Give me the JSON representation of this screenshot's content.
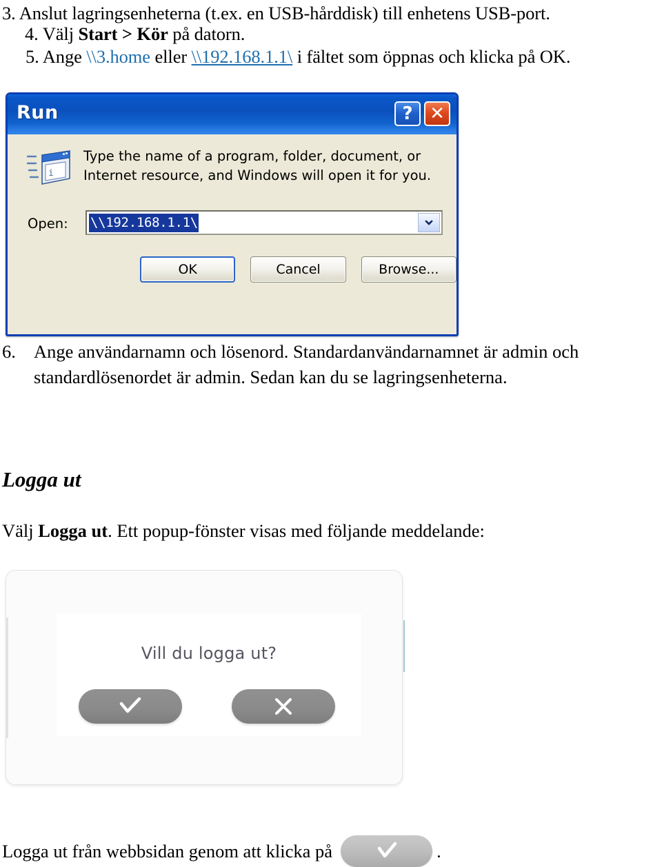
{
  "instructions": {
    "step3": {
      "number": "3.",
      "text": "Anslut lagringsenheterna (t.ex. en USB-hårddisk) till enhetens USB-port."
    },
    "step4": {
      "number": "4.",
      "prefix": "Välj ",
      "bold": "Start > Kör",
      "suffix": " på datorn."
    },
    "step5": {
      "number": "5.",
      "prefix": "Ange ",
      "link1": "\\\\3.home",
      "middle": " eller ",
      "link2": "\\\\192.168.1.1\\",
      "suffix": " i fältet som öppnas och klicka på OK."
    },
    "step6": {
      "number": "6.",
      "text": "Ange användarnamn och lösenord. Standardanvändarnamnet är admin och standardlösenordet är admin. Sedan kan du se lagringsenheterna."
    }
  },
  "run_dialog": {
    "title": "Run",
    "help_button": "?",
    "close_button": "✕",
    "description": "Type the name of a program, folder, document, or Internet resource, and Windows will open it for you.",
    "open_label": "Open:",
    "open_value": "\\\\192.168.1.1\\",
    "buttons": {
      "ok": "OK",
      "cancel": "Cancel",
      "browse": "Browse..."
    },
    "icon": "run-window-icon",
    "dropdown_icon": "chevron-down-icon",
    "selection_color": "#16389c",
    "titlebar_color": "#0b57c8"
  },
  "logout_section": {
    "heading": "Logga ut",
    "intro_prefix": "Välj ",
    "intro_bold": "Logga ut",
    "intro_suffix": ". Ett popup-fönster visas med följande meddelande:",
    "popup": {
      "question": "Vill du logga ut?",
      "confirm_icon": "checkmark-icon",
      "cancel_icon": "close-x-icon",
      "button_color": "#8b8b8b"
    },
    "final_prefix": "Logga ut från webbsidan genom att klicka på",
    "final_button_icon": "checkmark-icon",
    "final_suffix": "."
  }
}
